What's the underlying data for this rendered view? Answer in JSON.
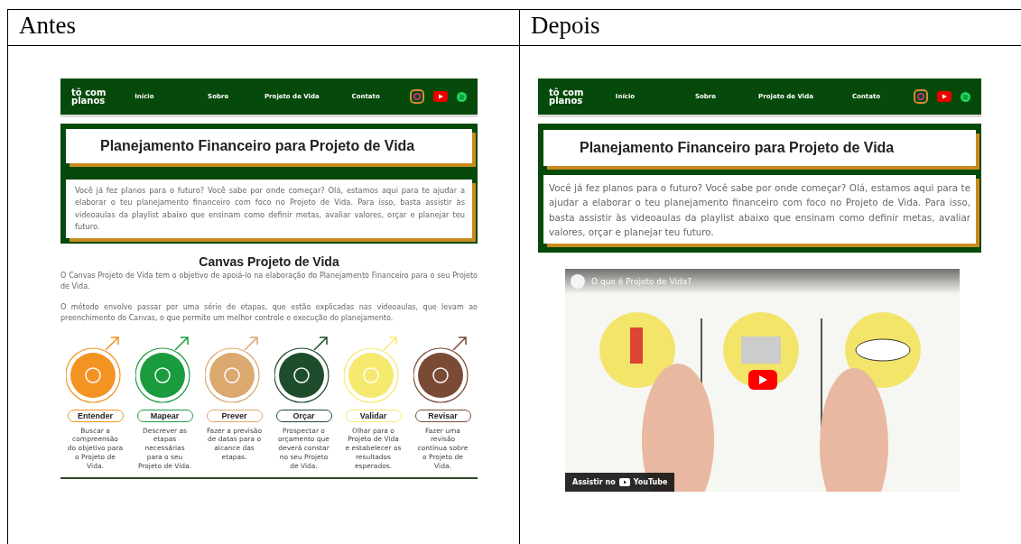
{
  "table": {
    "headers": [
      "Antes",
      "Depois"
    ]
  },
  "before": {
    "nav": {
      "logo": "tô com planos",
      "links": [
        "Início",
        "Sobre",
        "Projeto de Vida",
        "Contato"
      ]
    },
    "hero": {
      "title": "Planejamento Financeiro para Projeto de Vida",
      "intro": "Você já fez planos para o futuro? Você sabe por onde começar? Olá, estamos aqui para te ajudar a elaborar o teu planejamento financeiro com foco no Projeto de Vida. Para isso, basta assistir às videoaulas da playlist abaixo que ensinam como definir metas, avaliar valores, orçar e planejar teu futuro."
    },
    "canvas": {
      "title": "Canvas Projeto de Vida",
      "paragraphs": [
        "O Canvas Projeto de Vida tem o objetivo de apoiá-lo na elaboração do Planejamento Financeiro para o seu Projeto de Vida.",
        "O método envolve passar por uma série de etapas, que estão explicadas nas videoaulas, que levam ao preenchimento do Canvas, o que permite um melhor controle e execução do planejamento."
      ],
      "steps": [
        {
          "label": "Entender",
          "description": "Buscar a compreensão do objetivo para o Projeto de Vida.",
          "color": "#f39322"
        },
        {
          "label": "Mapear",
          "description": "Descrever as etapas necessárias para o seu Projeto de Vida.",
          "color": "#1a9c3e"
        },
        {
          "label": "Prever",
          "description": "Fazer a previsão de datas para o alcance das etapas.",
          "color": "#dba870"
        },
        {
          "label": "Orçar",
          "description": "Prospectar o orçamento que deverá constar no seu Projeto de Vida.",
          "color": "#1e4d2b"
        },
        {
          "label": "Validar",
          "description": "Olhar para o Projeto de Vida e estabelecer os resultados esperados.",
          "color": "#f5ea6e"
        },
        {
          "label": "Revisar",
          "description": "Fazer uma revisão contínua sobre o Projeto de Vida.",
          "color": "#7a4a35"
        }
      ]
    }
  },
  "after": {
    "nav": {
      "logo": "tô com planos",
      "links": [
        "Início",
        "Sobre",
        "Projeto de Vida",
        "Contato"
      ]
    },
    "hero": {
      "title": "Planejamento Financeiro para Projeto de Vida",
      "intro": "Você já fez planos para o futuro? Você sabe por onde começar? Olá, estamos aqui para te ajudar a elaborar o teu planejamento financeiro com foco no Projeto de Vida. Para isso, basta assistir às videoaulas da playlist abaixo que ensinam como definir metas, avaliar valores, orçar e planejar teu futuro."
    },
    "video": {
      "kind": "picture",
      "title": "O que é Projeto de Vida?",
      "watch_label": "Assistir no",
      "platform": "YouTube"
    }
  }
}
